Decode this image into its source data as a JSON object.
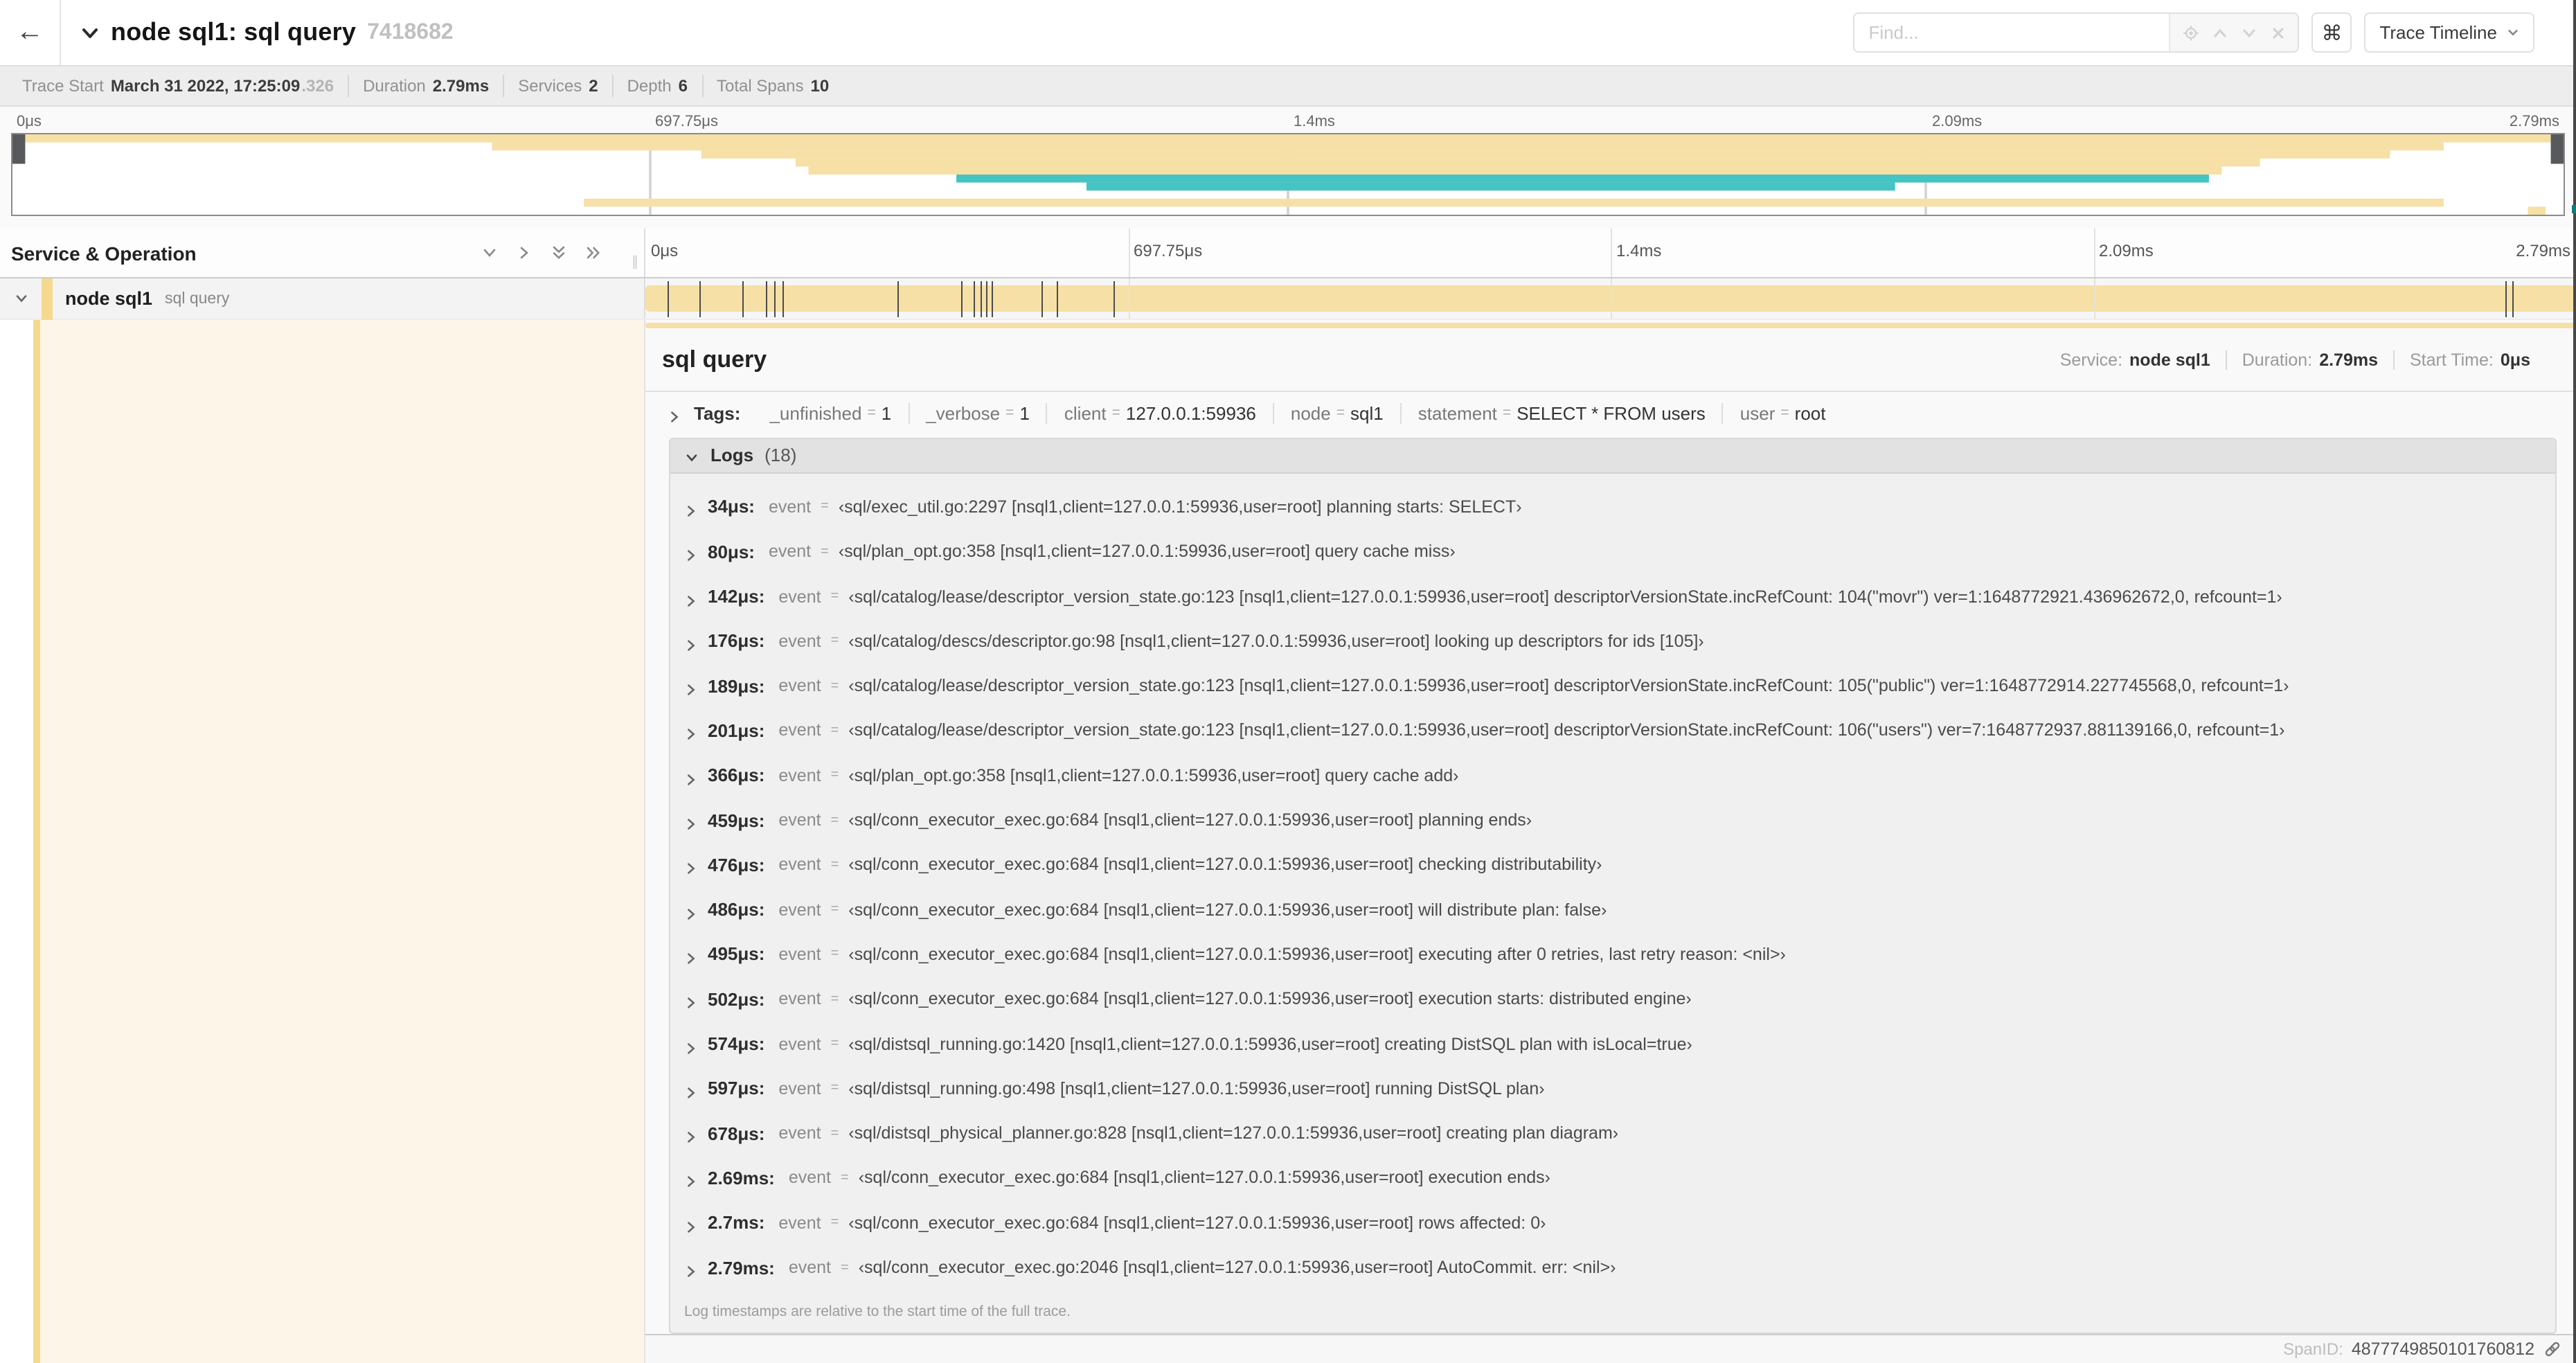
{
  "header": {
    "title": "node sql1: sql query",
    "trace_id": "7418682",
    "find_placeholder": "Find...",
    "shortcut_glyph": "⌘",
    "view_dropdown": "Trace Timeline"
  },
  "trace_info": [
    {
      "label": "Trace Start",
      "value": "March 31 2022, 17:25:09",
      "extra": ".326"
    },
    {
      "label": "Duration",
      "value": "2.79ms"
    },
    {
      "label": "Services",
      "value": "2"
    },
    {
      "label": "Depth",
      "value": "6"
    },
    {
      "label": "Total Spans",
      "value": "10"
    }
  ],
  "timeline_ruler": {
    "ticks": [
      "0μs",
      "697.75μs",
      "1.4ms",
      "2.09ms",
      "2.79ms"
    ],
    "positions_pct": [
      0,
      25,
      50,
      75,
      100
    ],
    "grid_pct": [
      25,
      50,
      75
    ]
  },
  "minimap": {
    "bars": [
      {
        "row": 0,
        "color": "tan",
        "start_pct": 0,
        "end_pct": 100
      },
      {
        "row": 1,
        "color": "tan",
        "start_pct": 18.8,
        "end_pct": 95.3
      },
      {
        "row": 2,
        "color": "tan",
        "start_pct": 27.0,
        "end_pct": 93.2
      },
      {
        "row": 3,
        "color": "tan",
        "start_pct": 30.7,
        "end_pct": 88.1
      },
      {
        "row": 4,
        "color": "tan",
        "start_pct": 31.2,
        "end_pct": 86.6
      },
      {
        "row": 5,
        "color": "teal",
        "start_pct": 37.0,
        "end_pct": 86.1
      },
      {
        "row": 6,
        "color": "teal",
        "start_pct": 42.1,
        "end_pct": 73.8
      },
      {
        "row": 8,
        "color": "tan",
        "start_pct": 22.4,
        "end_pct": 95.3
      },
      {
        "row": 9,
        "color": "tan",
        "start_pct": 98.6,
        "end_pct": 99.3
      }
    ],
    "rows_total": 10
  },
  "colors": {
    "span_tan": "#F6E0A6",
    "span_teal": "#46C4C4",
    "expanded_cream": "#FDF6E8",
    "accent_stripe": "#F5D98F",
    "tick_mark": "#4c4c4c"
  },
  "left_panel": {
    "header": "Service & Operation"
  },
  "span_row": {
    "service": "node sql1",
    "operation": "sql query",
    "tick_times_us": [
      34,
      80,
      142,
      176,
      189,
      201,
      366,
      459,
      476,
      486,
      495,
      502,
      574,
      597,
      678,
      2690,
      2700,
      2790
    ],
    "total_us": 2790
  },
  "detail": {
    "title": "sql query",
    "meta": [
      {
        "label": "Service:",
        "value": "node sql1"
      },
      {
        "label": "Duration:",
        "value": "2.79ms"
      },
      {
        "label": "Start Time:",
        "value": "0μs"
      }
    ],
    "tags_label": "Tags:",
    "tags": [
      {
        "key": "_unfinished",
        "value": "1"
      },
      {
        "key": "_verbose",
        "value": "1"
      },
      {
        "key": "client",
        "value": "127.0.0.1:59936"
      },
      {
        "key": "node",
        "value": "sql1"
      },
      {
        "key": "statement",
        "value": "SELECT * FROM users"
      },
      {
        "key": "user",
        "value": "root"
      }
    ],
    "logs_label": "Logs",
    "logs_count": "(18)",
    "logs_field_label": "event",
    "eq_symbol": "=",
    "logs": [
      {
        "time": "34μs:",
        "value": "‹sql/exec_util.go:2297 [nsql1,client=127.0.0.1:59936,user=root] planning starts: SELECT›"
      },
      {
        "time": "80μs:",
        "value": "‹sql/plan_opt.go:358 [nsql1,client=127.0.0.1:59936,user=root] query cache miss›"
      },
      {
        "time": "142μs:",
        "value": "‹sql/catalog/lease/descriptor_version_state.go:123 [nsql1,client=127.0.0.1:59936,user=root] descriptorVersionState.incRefCount: 104(\"movr\") ver=1:1648772921.436962672,0, refcount=1›"
      },
      {
        "time": "176μs:",
        "value": "‹sql/catalog/descs/descriptor.go:98 [nsql1,client=127.0.0.1:59936,user=root] looking up descriptors for ids [105]›"
      },
      {
        "time": "189μs:",
        "value": "‹sql/catalog/lease/descriptor_version_state.go:123 [nsql1,client=127.0.0.1:59936,user=root] descriptorVersionState.incRefCount: 105(\"public\") ver=1:1648772914.227745568,0, refcount=1›"
      },
      {
        "time": "201μs:",
        "value": "‹sql/catalog/lease/descriptor_version_state.go:123 [nsql1,client=127.0.0.1:59936,user=root] descriptorVersionState.incRefCount: 106(\"users\") ver=7:1648772937.881139166,0, refcount=1›"
      },
      {
        "time": "366μs:",
        "value": "‹sql/plan_opt.go:358 [nsql1,client=127.0.0.1:59936,user=root] query cache add›"
      },
      {
        "time": "459μs:",
        "value": "‹sql/conn_executor_exec.go:684 [nsql1,client=127.0.0.1:59936,user=root] planning ends›"
      },
      {
        "time": "476μs:",
        "value": "‹sql/conn_executor_exec.go:684 [nsql1,client=127.0.0.1:59936,user=root] checking distributability›"
      },
      {
        "time": "486μs:",
        "value": "‹sql/conn_executor_exec.go:684 [nsql1,client=127.0.0.1:59936,user=root] will distribute plan: false›"
      },
      {
        "time": "495μs:",
        "value": "‹sql/conn_executor_exec.go:684 [nsql1,client=127.0.0.1:59936,user=root] executing after 0 retries, last retry reason: <nil>›"
      },
      {
        "time": "502μs:",
        "value": "‹sql/conn_executor_exec.go:684 [nsql1,client=127.0.0.1:59936,user=root] execution starts: distributed engine›"
      },
      {
        "time": "574μs:",
        "value": "‹sql/distsql_running.go:1420 [nsql1,client=127.0.0.1:59936,user=root] creating DistSQL plan with isLocal=true›"
      },
      {
        "time": "597μs:",
        "value": "‹sql/distsql_running.go:498 [nsql1,client=127.0.0.1:59936,user=root] running DistSQL plan›"
      },
      {
        "time": "678μs:",
        "value": "‹sql/distsql_physical_planner.go:828 [nsql1,client=127.0.0.1:59936,user=root] creating plan diagram›"
      },
      {
        "time": "2.69ms:",
        "value": "‹sql/conn_executor_exec.go:684 [nsql1,client=127.0.0.1:59936,user=root] execution ends›"
      },
      {
        "time": "2.7ms:",
        "value": "‹sql/conn_executor_exec.go:684 [nsql1,client=127.0.0.1:59936,user=root] rows affected: 0›"
      },
      {
        "time": "2.79ms:",
        "value": "‹sql/conn_executor_exec.go:2046 [nsql1,client=127.0.0.1:59936,user=root] AutoCommit. err: <nil>›"
      }
    ],
    "footer_note": "Log timestamps are relative to the start time of the full trace.",
    "span_id_label": "SpanID:",
    "span_id": "4877749850101760812"
  }
}
